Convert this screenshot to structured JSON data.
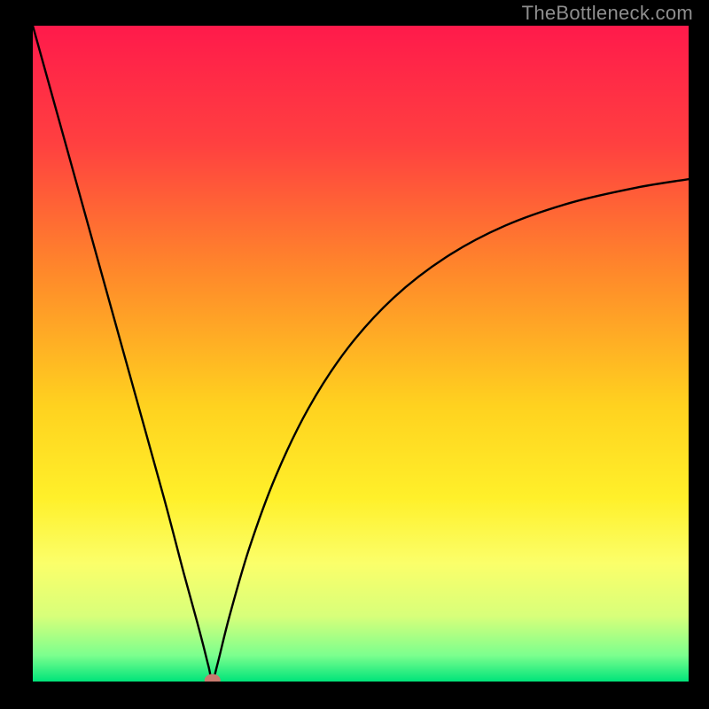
{
  "watermark": "TheBottleneck.com",
  "chart_data": {
    "type": "line",
    "title": "",
    "xlabel": "",
    "ylabel": "",
    "xlim": [
      0,
      100
    ],
    "ylim": [
      0,
      100
    ],
    "grid": false,
    "legend": false,
    "background_gradient": {
      "stops": [
        {
          "offset": 0.0,
          "color": "#ff1a4b"
        },
        {
          "offset": 0.18,
          "color": "#ff4040"
        },
        {
          "offset": 0.38,
          "color": "#ff8a2a"
        },
        {
          "offset": 0.58,
          "color": "#ffd21f"
        },
        {
          "offset": 0.72,
          "color": "#fff02a"
        },
        {
          "offset": 0.82,
          "color": "#fbff6a"
        },
        {
          "offset": 0.9,
          "color": "#d8ff7a"
        },
        {
          "offset": 0.96,
          "color": "#7cff8e"
        },
        {
          "offset": 1.0,
          "color": "#00e47a"
        }
      ]
    },
    "x": [
      0,
      5,
      10,
      15,
      20,
      23,
      25,
      26,
      26.8,
      27.4,
      28.2,
      30,
      33,
      37,
      42,
      48,
      55,
      63,
      72,
      82,
      92,
      100
    ],
    "values": [
      100,
      82,
      64,
      46,
      28,
      16.6,
      9.3,
      5.5,
      2.3,
      0.2,
      2.8,
      10.0,
      20.3,
      31.2,
      41.6,
      50.8,
      58.5,
      64.7,
      69.5,
      73.0,
      75.3,
      76.6
    ],
    "minimum_marker": {
      "x": 27.4,
      "y": 0.2,
      "color": "#c97a6f"
    }
  }
}
